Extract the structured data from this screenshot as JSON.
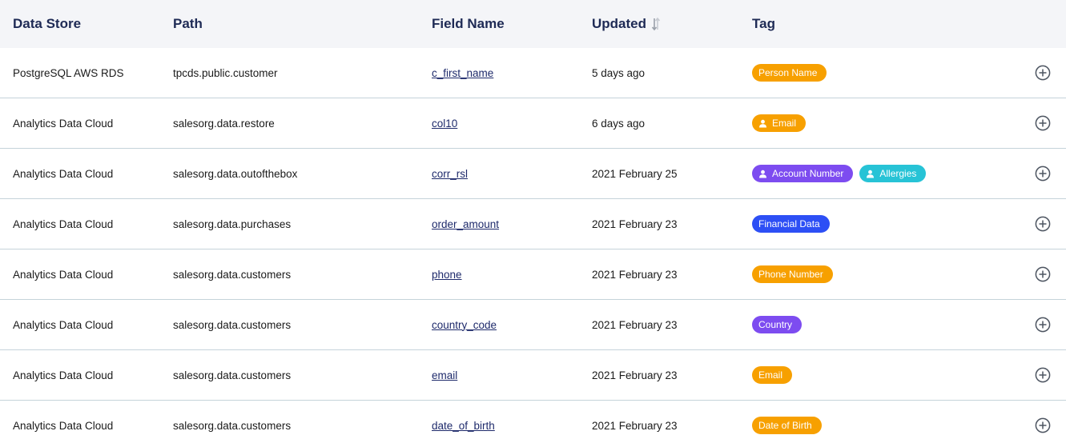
{
  "columns": {
    "data_store": "Data Store",
    "path": "Path",
    "field_name": "Field Name",
    "updated": "Updated",
    "tag": "Tag"
  },
  "colors": {
    "orange": "#f7a000",
    "purple": "#7d4cf0",
    "teal": "#27c3d6",
    "blue": "#2d4ff5"
  },
  "rows": [
    {
      "data_store": "PostgreSQL AWS RDS",
      "path": "tpcds.public.customer",
      "field_name": "c_first_name",
      "updated": "5 days ago",
      "tags": [
        {
          "label": "Person Name",
          "color": "orange",
          "icon": false
        }
      ]
    },
    {
      "data_store": "Analytics Data Cloud",
      "path": "salesorg.data.restore",
      "field_name": "col10",
      "updated": "6 days ago",
      "tags": [
        {
          "label": "Email",
          "color": "orange",
          "icon": true
        }
      ]
    },
    {
      "data_store": "Analytics Data Cloud",
      "path": "salesorg.data.outofthebox",
      "field_name": "corr_rsl",
      "updated": "2021 February 25",
      "tags": [
        {
          "label": "Account Number",
          "color": "purple",
          "icon": true
        },
        {
          "label": "Allergies",
          "color": "teal",
          "icon": true
        }
      ]
    },
    {
      "data_store": "Analytics Data Cloud",
      "path": "salesorg.data.purchases",
      "field_name": "order_amount",
      "updated": "2021 February 23",
      "tags": [
        {
          "label": "Financial Data",
          "color": "blue",
          "icon": false
        }
      ]
    },
    {
      "data_store": "Analytics Data Cloud",
      "path": "salesorg.data.customers",
      "field_name": "phone",
      "updated": "2021 February 23",
      "tags": [
        {
          "label": "Phone Number",
          "color": "orange",
          "icon": false
        }
      ]
    },
    {
      "data_store": "Analytics Data Cloud",
      "path": "salesorg.data.customers",
      "field_name": "country_code",
      "updated": "2021 February 23",
      "tags": [
        {
          "label": "Country",
          "color": "purple",
          "icon": false
        }
      ]
    },
    {
      "data_store": "Analytics Data Cloud",
      "path": "salesorg.data.customers",
      "field_name": "email",
      "updated": "2021 February 23",
      "tags": [
        {
          "label": "Email",
          "color": "orange",
          "icon": false
        }
      ]
    },
    {
      "data_store": "Analytics Data Cloud",
      "path": "salesorg.data.customers",
      "field_name": "date_of_birth",
      "updated": "2021 February 23",
      "tags": [
        {
          "label": "Date of Birth",
          "color": "orange",
          "icon": false
        }
      ]
    }
  ],
  "icons": {
    "sort": "sort-arrows-icon",
    "person": "person-icon",
    "add": "plus-circle-icon"
  }
}
